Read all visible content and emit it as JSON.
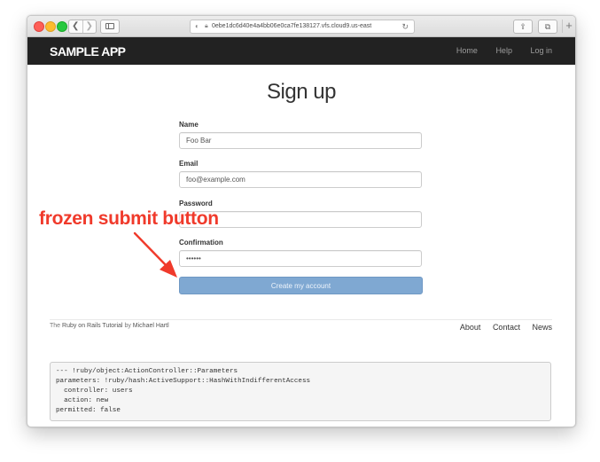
{
  "browser": {
    "url": "0ebe1dc6d40e4a4bb06e0ca7fe138127.vfs.cloud9.us-east"
  },
  "header": {
    "logo": "SAMPLE APP",
    "nav": [
      "Home",
      "Help",
      "Log in"
    ]
  },
  "page": {
    "title": "Sign up"
  },
  "form": {
    "name_label": "Name",
    "name_value": "Foo Bar",
    "email_label": "Email",
    "email_value": "foo@example.com",
    "password_label": "Password",
    "password_value": "",
    "confirmation_label": "Confirmation",
    "confirmation_value": "••••••",
    "submit_label": "Create my account"
  },
  "footer": {
    "credit_prefix": "The ",
    "credit_link": "Ruby on Rails Tutorial",
    "credit_by": " by ",
    "credit_author": "Michael Hartl",
    "nav": [
      "About",
      "Contact",
      "News"
    ]
  },
  "debug": {
    "lines": [
      "--- !ruby/object:ActionController::Parameters",
      "parameters: !ruby/hash:ActiveSupport::HashWithIndifferentAccess",
      "  controller: users",
      "  action: new",
      "permitted: false"
    ]
  },
  "annotation": {
    "text": "frozen submit button",
    "color": "#f03a2b"
  },
  "colors": {
    "header_bg": "#222222",
    "submit_bg": "#7fa8d2",
    "debug_bg": "#f5f5f5"
  }
}
